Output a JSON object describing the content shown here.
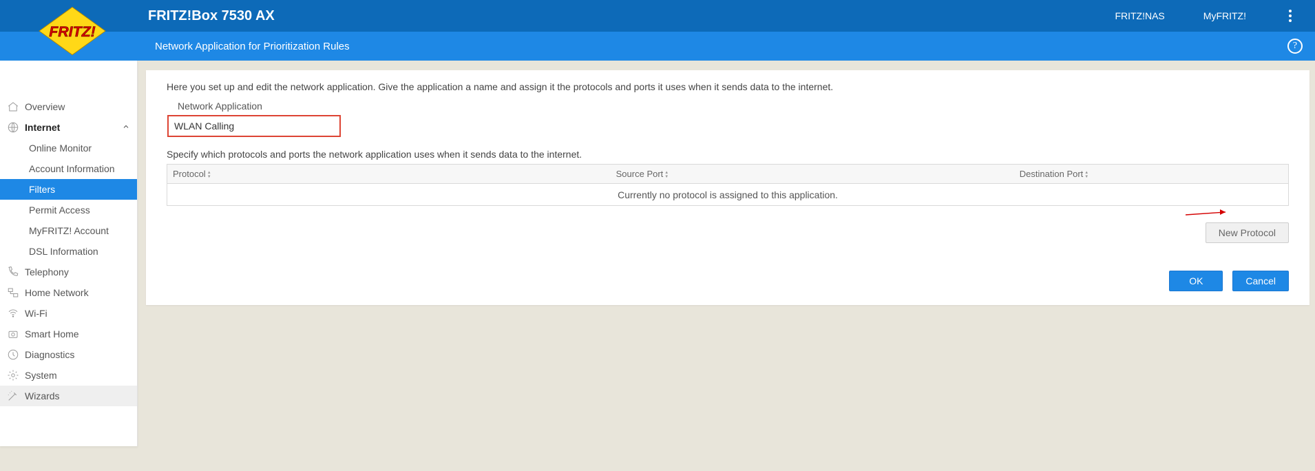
{
  "header": {
    "product": "FRITZ!Box 7530 AX",
    "link_nas": "FRITZ!NAS",
    "link_myfritz": "MyFRITZ!"
  },
  "subheader": {
    "title": "Network Application for Prioritization Rules"
  },
  "sidebar": {
    "overview": "Overview",
    "internet": {
      "label": "Internet",
      "online_monitor": "Online Monitor",
      "account_info": "Account Information",
      "filters": "Filters",
      "permit": "Permit Access",
      "myfritz": "MyFRITZ! Account",
      "dsl": "DSL Information"
    },
    "telephony": "Telephony",
    "home_network": "Home Network",
    "wifi": "Wi-Fi",
    "smart_home": "Smart Home",
    "diagnostics": "Diagnostics",
    "system": "System",
    "wizards": "Wizards"
  },
  "main": {
    "intro": "Here you set up and edit the network application. Give the application a name and assign it the protocols and ports it uses when it sends data to the internet.",
    "field_label": "Network Application",
    "app_name_value": "WLAN Calling",
    "note": "Specify which protocols and ports the network application uses when it sends data to the internet.",
    "table": {
      "col_protocol": "Protocol",
      "col_source": "Source Port",
      "col_dest": "Destination Port",
      "empty": "Currently no protocol is assigned to this application."
    },
    "btn_new": "New Protocol",
    "btn_ok": "OK",
    "btn_cancel": "Cancel"
  }
}
